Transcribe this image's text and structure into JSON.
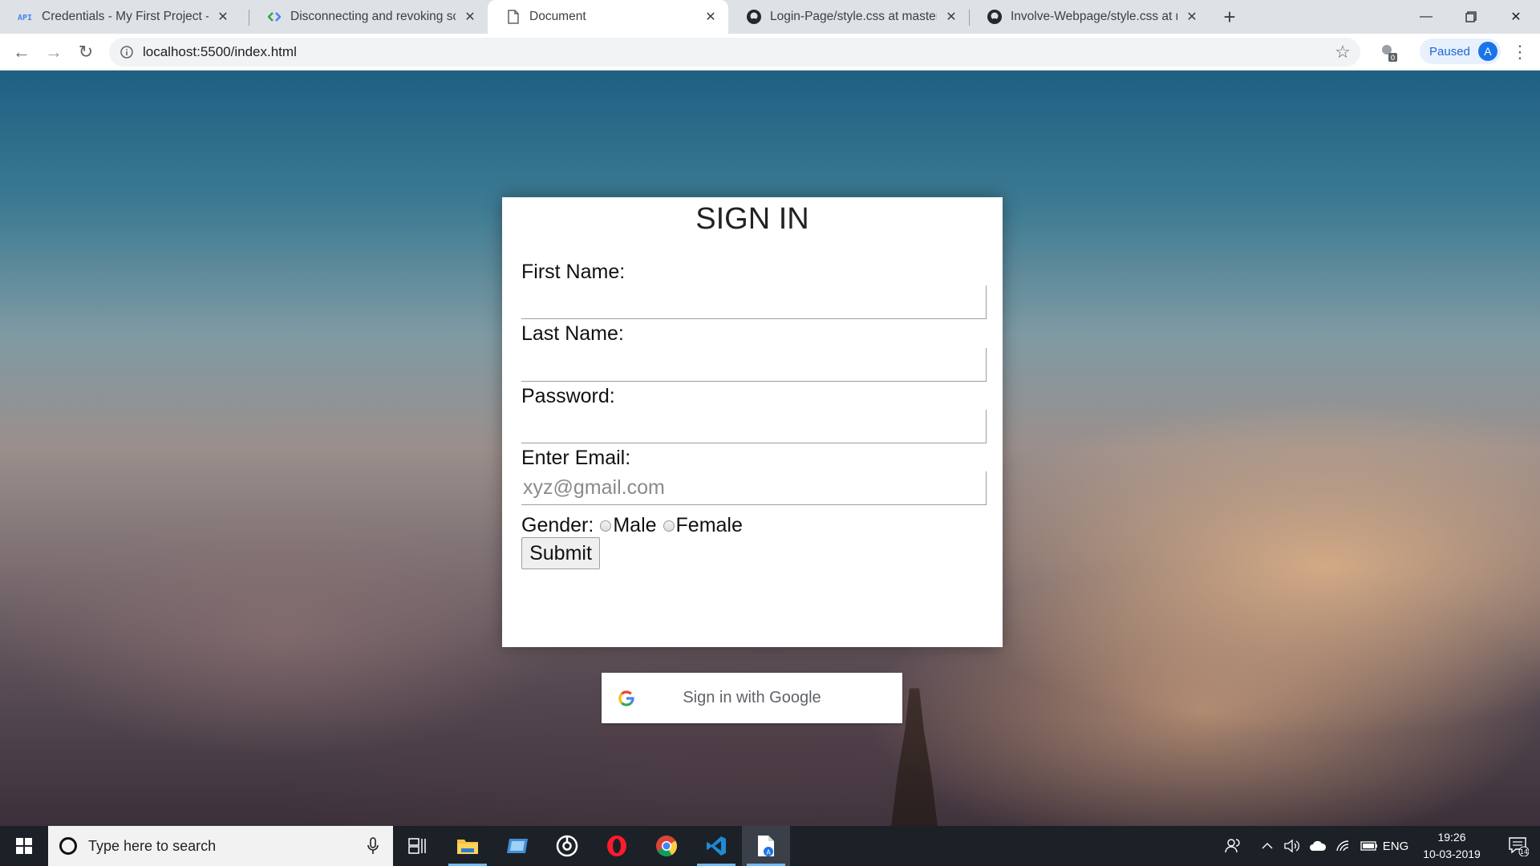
{
  "browser": {
    "tabs": [
      {
        "title": "Credentials - My First Project - G",
        "favicon": "api-icon",
        "active": false
      },
      {
        "title": "Disconnecting and revoking scop",
        "favicon": "google-dev-icon",
        "active": false
      },
      {
        "title": "Document",
        "favicon": "document-icon",
        "active": true
      },
      {
        "title": "Login-Page/style.css at master · g",
        "favicon": "github-icon",
        "active": false
      },
      {
        "title": "Involve-Webpage/style.css at ma",
        "favicon": "github-icon",
        "active": false
      }
    ],
    "url": "localhost:5500/index.html",
    "profile_status": "Paused",
    "profile_initial": "A",
    "extension_badge": "0"
  },
  "page": {
    "title": "SIGN IN",
    "first_name_label": "First Name:",
    "last_name_label": "Last Name:",
    "password_label": "Password:",
    "email_label": "Enter Email:",
    "email_placeholder": "xyz@gmail.com",
    "gender_label": "Gender:",
    "gender_options": [
      "Male",
      "Female"
    ],
    "submit_label": "Submit",
    "google_button_label": "Sign in with Google"
  },
  "taskbar": {
    "search_placeholder": "Type here to search",
    "language": "ENG",
    "time": "19:26",
    "date": "10-03-2019",
    "notification_count": "14"
  },
  "colors": {
    "accent": "#1a73e8",
    "taskbar": "#1c2127",
    "tabstrip": "#dee1e6"
  }
}
